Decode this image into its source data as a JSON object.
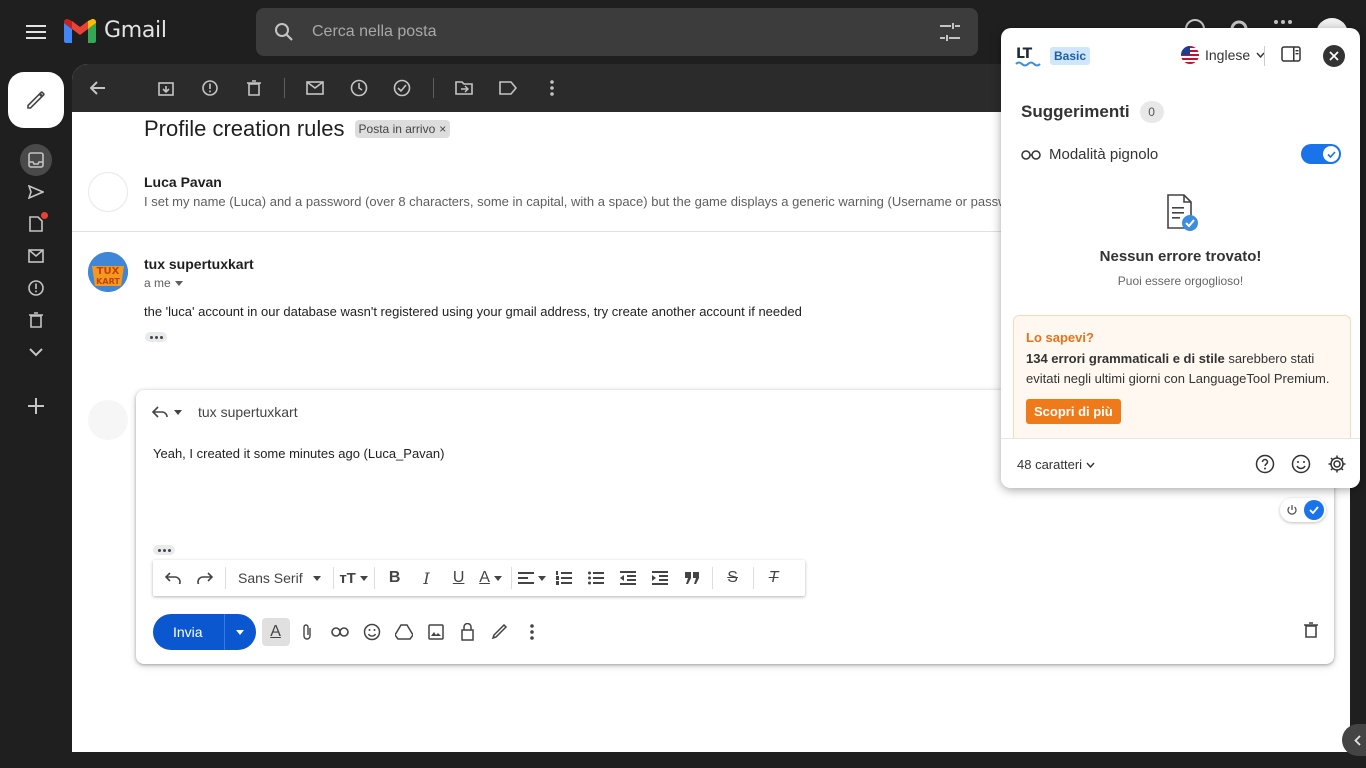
{
  "app": {
    "name": "Gmail"
  },
  "search": {
    "placeholder": "Cerca nella posta"
  },
  "thread": {
    "subject": "Profile creation rules",
    "label": "Posta in arrivo",
    "messages": [
      {
        "sender": "Luca Pavan",
        "snippet": "I set my name (Luca) and a password (over 8 characters, some in capital, with a space) but the game displays a generic warning (Username or passw"
      },
      {
        "sender": "tux supertuxkart",
        "recipient": "a me",
        "body": "the 'luca' account in our database wasn't registered using your gmail address, try create another account if needed"
      }
    ]
  },
  "reply": {
    "to": "tux supertuxkart",
    "text": "Yeah, I created it some minutes ago (Luca_Pavan)",
    "font": "Sans Serif",
    "send_label": "Invia"
  },
  "languagetool": {
    "plan": "Basic",
    "language": "Inglese",
    "suggestions_title": "Suggerimenti",
    "suggestions_count": "0",
    "pedantic_label": "Modalità pignolo",
    "pedantic_on": true,
    "no_errors_title": "Nessun errore trovato!",
    "no_errors_sub": "Puoi essere orgoglioso!",
    "tip_title": "Lo sapevi?",
    "tip_bold": "134 errori grammaticali e di stile",
    "tip_rest": " sarebbero stati evitati negli ultimi giorni con LanguageTool Premium.",
    "tip_button": "Scopri di più",
    "char_count": "48 caratteri"
  },
  "colors": {
    "gmail_dark": "#1f1f1f",
    "send_blue": "#0b57d0",
    "lt_orange": "#ef7a1a",
    "toggle_blue": "#1a73e8"
  }
}
